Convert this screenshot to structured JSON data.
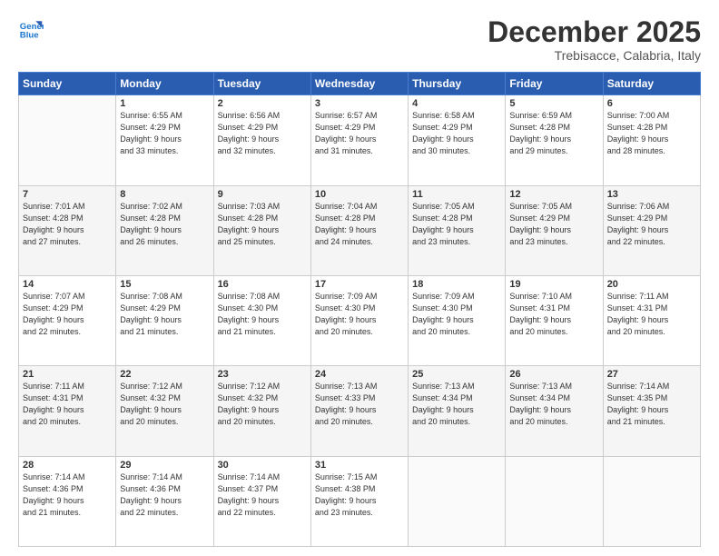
{
  "logo": {
    "line1": "General",
    "line2": "Blue"
  },
  "header": {
    "month": "December 2025",
    "location": "Trebisacce, Calabria, Italy"
  },
  "weekdays": [
    "Sunday",
    "Monday",
    "Tuesday",
    "Wednesday",
    "Thursday",
    "Friday",
    "Saturday"
  ],
  "weeks": [
    [
      {
        "day": "",
        "info": ""
      },
      {
        "day": "1",
        "info": "Sunrise: 6:55 AM\nSunset: 4:29 PM\nDaylight: 9 hours\nand 33 minutes."
      },
      {
        "day": "2",
        "info": "Sunrise: 6:56 AM\nSunset: 4:29 PM\nDaylight: 9 hours\nand 32 minutes."
      },
      {
        "day": "3",
        "info": "Sunrise: 6:57 AM\nSunset: 4:29 PM\nDaylight: 9 hours\nand 31 minutes."
      },
      {
        "day": "4",
        "info": "Sunrise: 6:58 AM\nSunset: 4:29 PM\nDaylight: 9 hours\nand 30 minutes."
      },
      {
        "day": "5",
        "info": "Sunrise: 6:59 AM\nSunset: 4:28 PM\nDaylight: 9 hours\nand 29 minutes."
      },
      {
        "day": "6",
        "info": "Sunrise: 7:00 AM\nSunset: 4:28 PM\nDaylight: 9 hours\nand 28 minutes."
      }
    ],
    [
      {
        "day": "7",
        "info": "Sunrise: 7:01 AM\nSunset: 4:28 PM\nDaylight: 9 hours\nand 27 minutes."
      },
      {
        "day": "8",
        "info": "Sunrise: 7:02 AM\nSunset: 4:28 PM\nDaylight: 9 hours\nand 26 minutes."
      },
      {
        "day": "9",
        "info": "Sunrise: 7:03 AM\nSunset: 4:28 PM\nDaylight: 9 hours\nand 25 minutes."
      },
      {
        "day": "10",
        "info": "Sunrise: 7:04 AM\nSunset: 4:28 PM\nDaylight: 9 hours\nand 24 minutes."
      },
      {
        "day": "11",
        "info": "Sunrise: 7:05 AM\nSunset: 4:28 PM\nDaylight: 9 hours\nand 23 minutes."
      },
      {
        "day": "12",
        "info": "Sunrise: 7:05 AM\nSunset: 4:29 PM\nDaylight: 9 hours\nand 23 minutes."
      },
      {
        "day": "13",
        "info": "Sunrise: 7:06 AM\nSunset: 4:29 PM\nDaylight: 9 hours\nand 22 minutes."
      }
    ],
    [
      {
        "day": "14",
        "info": "Sunrise: 7:07 AM\nSunset: 4:29 PM\nDaylight: 9 hours\nand 22 minutes."
      },
      {
        "day": "15",
        "info": "Sunrise: 7:08 AM\nSunset: 4:29 PM\nDaylight: 9 hours\nand 21 minutes."
      },
      {
        "day": "16",
        "info": "Sunrise: 7:08 AM\nSunset: 4:30 PM\nDaylight: 9 hours\nand 21 minutes."
      },
      {
        "day": "17",
        "info": "Sunrise: 7:09 AM\nSunset: 4:30 PM\nDaylight: 9 hours\nand 20 minutes."
      },
      {
        "day": "18",
        "info": "Sunrise: 7:09 AM\nSunset: 4:30 PM\nDaylight: 9 hours\nand 20 minutes."
      },
      {
        "day": "19",
        "info": "Sunrise: 7:10 AM\nSunset: 4:31 PM\nDaylight: 9 hours\nand 20 minutes."
      },
      {
        "day": "20",
        "info": "Sunrise: 7:11 AM\nSunset: 4:31 PM\nDaylight: 9 hours\nand 20 minutes."
      }
    ],
    [
      {
        "day": "21",
        "info": "Sunrise: 7:11 AM\nSunset: 4:31 PM\nDaylight: 9 hours\nand 20 minutes."
      },
      {
        "day": "22",
        "info": "Sunrise: 7:12 AM\nSunset: 4:32 PM\nDaylight: 9 hours\nand 20 minutes."
      },
      {
        "day": "23",
        "info": "Sunrise: 7:12 AM\nSunset: 4:32 PM\nDaylight: 9 hours\nand 20 minutes."
      },
      {
        "day": "24",
        "info": "Sunrise: 7:13 AM\nSunset: 4:33 PM\nDaylight: 9 hours\nand 20 minutes."
      },
      {
        "day": "25",
        "info": "Sunrise: 7:13 AM\nSunset: 4:34 PM\nDaylight: 9 hours\nand 20 minutes."
      },
      {
        "day": "26",
        "info": "Sunrise: 7:13 AM\nSunset: 4:34 PM\nDaylight: 9 hours\nand 20 minutes."
      },
      {
        "day": "27",
        "info": "Sunrise: 7:14 AM\nSunset: 4:35 PM\nDaylight: 9 hours\nand 21 minutes."
      }
    ],
    [
      {
        "day": "28",
        "info": "Sunrise: 7:14 AM\nSunset: 4:36 PM\nDaylight: 9 hours\nand 21 minutes."
      },
      {
        "day": "29",
        "info": "Sunrise: 7:14 AM\nSunset: 4:36 PM\nDaylight: 9 hours\nand 22 minutes."
      },
      {
        "day": "30",
        "info": "Sunrise: 7:14 AM\nSunset: 4:37 PM\nDaylight: 9 hours\nand 22 minutes."
      },
      {
        "day": "31",
        "info": "Sunrise: 7:15 AM\nSunset: 4:38 PM\nDaylight: 9 hours\nand 23 minutes."
      },
      {
        "day": "",
        "info": ""
      },
      {
        "day": "",
        "info": ""
      },
      {
        "day": "",
        "info": ""
      }
    ]
  ]
}
